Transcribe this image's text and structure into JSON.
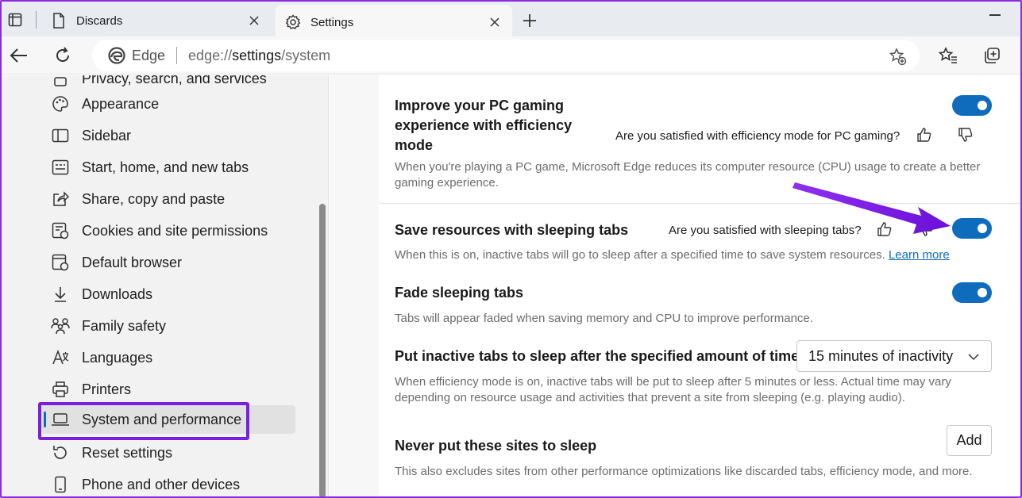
{
  "tabs": [
    {
      "label": "Discards",
      "icon": "page-icon",
      "active": false
    },
    {
      "label": "Settings",
      "icon": "gear-icon",
      "active": true
    }
  ],
  "address": {
    "site": "Edge",
    "url_prefix": "edge://",
    "url_host": "settings",
    "url_path": "/system"
  },
  "sidebar": {
    "partial_item": "Privacy, search, and services",
    "items": [
      {
        "label": "Appearance",
        "icon": "palette-icon"
      },
      {
        "label": "Sidebar",
        "icon": "sidebar-icon"
      },
      {
        "label": "Start, home, and new tabs",
        "icon": "home-tab-icon"
      },
      {
        "label": "Share, copy and paste",
        "icon": "share-icon"
      },
      {
        "label": "Cookies and site permissions",
        "icon": "cookie-permissions-icon"
      },
      {
        "label": "Default browser",
        "icon": "browser-icon"
      },
      {
        "label": "Downloads",
        "icon": "download-icon"
      },
      {
        "label": "Family safety",
        "icon": "family-icon"
      },
      {
        "label": "Languages",
        "icon": "languages-icon"
      },
      {
        "label": "Printers",
        "icon": "printer-icon"
      },
      {
        "label": "System and performance",
        "icon": "laptop-icon",
        "selected": true
      },
      {
        "label": "Reset settings",
        "icon": "reset-icon"
      },
      {
        "label": "Phone and other devices",
        "icon": "phone-icon"
      }
    ]
  },
  "settings": {
    "gaming": {
      "title_line1": "Improve your PC gaming",
      "title_line2": "experience with efficiency",
      "title_line3": "mode",
      "feedback": "Are you satisfied with efficiency mode for PC gaming?",
      "desc_line1": "When you're playing a PC game, Microsoft Edge reduces its computer resource (CPU) usage to create a better",
      "desc_line2": "gaming experience.",
      "enabled": true
    },
    "sleeping_tabs": {
      "title": "Save resources with sleeping tabs",
      "feedback": "Are you satisfied with sleeping tabs?",
      "desc": "When this is on, inactive tabs will go to sleep after a specified time to save system resources.",
      "link": "Learn more",
      "enabled": true
    },
    "fade": {
      "title": "Fade sleeping tabs",
      "desc": "Tabs will appear faded when saving memory and CPU to improve performance.",
      "enabled": true
    },
    "inactive": {
      "title": "Put inactive tabs to sleep after the specified amount of time:",
      "selected": "15 minutes of inactivity",
      "desc_line1": "When efficiency mode is on, inactive tabs will be put to sleep after 5 minutes or less. Actual time may vary",
      "desc_line2": "depending on resource usage and activities that prevent a site from sleeping (e.g. playing audio)."
    },
    "never_sleep": {
      "title": "Never put these sites to sleep",
      "button": "Add",
      "desc": "This also excludes sites from other performance optimizations like discarded tabs, efficiency mode, and more."
    }
  },
  "colors": {
    "accent": "#0f6cbd",
    "annotation": "#7a1fe0"
  }
}
